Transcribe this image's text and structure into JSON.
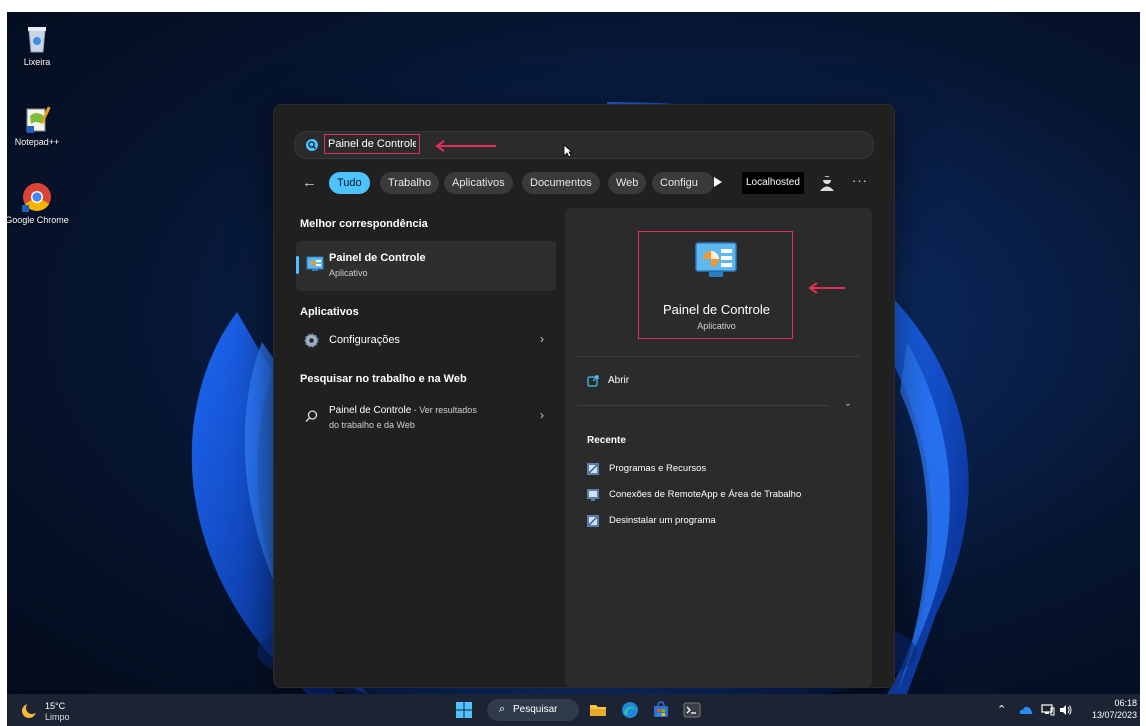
{
  "desktop": {
    "icons": [
      {
        "label": "Lixeira",
        "icon": "recycle-bin-icon"
      },
      {
        "label": "Notepad++",
        "icon": "notepad-plus-plus-icon"
      },
      {
        "label": "Google Chrome",
        "icon": "chrome-icon"
      }
    ]
  },
  "search": {
    "query": "Painel de Controle",
    "filters": [
      "Tudo",
      "Trabalho",
      "Aplicativos",
      "Documentos",
      "Web",
      "Configu"
    ],
    "active_filter": "Tudo",
    "account_label": "Localhosted",
    "more_label": "···",
    "back_glyph": "←"
  },
  "results": {
    "best_match_title": "Melhor correspondência",
    "best_match": {
      "name": "Painel de Controle",
      "type": "Aplicativo"
    },
    "apps_title": "Aplicativos",
    "apps": [
      {
        "name": "Configurações",
        "icon": "settings-gear-icon"
      }
    ],
    "web_title": "Pesquisar no trabalho e na Web",
    "web_item": {
      "name": "Painel de Controle",
      "suffix": " - Ver resultados",
      "line2": "do trabalho e da Web"
    }
  },
  "details": {
    "name": "Painel de Controle",
    "type": "Aplicativo",
    "action_open": "Abrir",
    "recent_title": "Recente",
    "recent": [
      "Programas e Recursos",
      "Conexões de RemoteApp e Área de Trabalho",
      "Desinstalar um programa"
    ]
  },
  "taskbar": {
    "weather_temp": "15°C",
    "weather_cond": "Limpo",
    "search_label": "Pesquisar",
    "time": "06:18",
    "date": "13/07/2023"
  },
  "colors": {
    "accent": "#4cc2ff",
    "annotation": "#e0305a",
    "panel": "#202020",
    "pane": "#2b2b2b"
  }
}
